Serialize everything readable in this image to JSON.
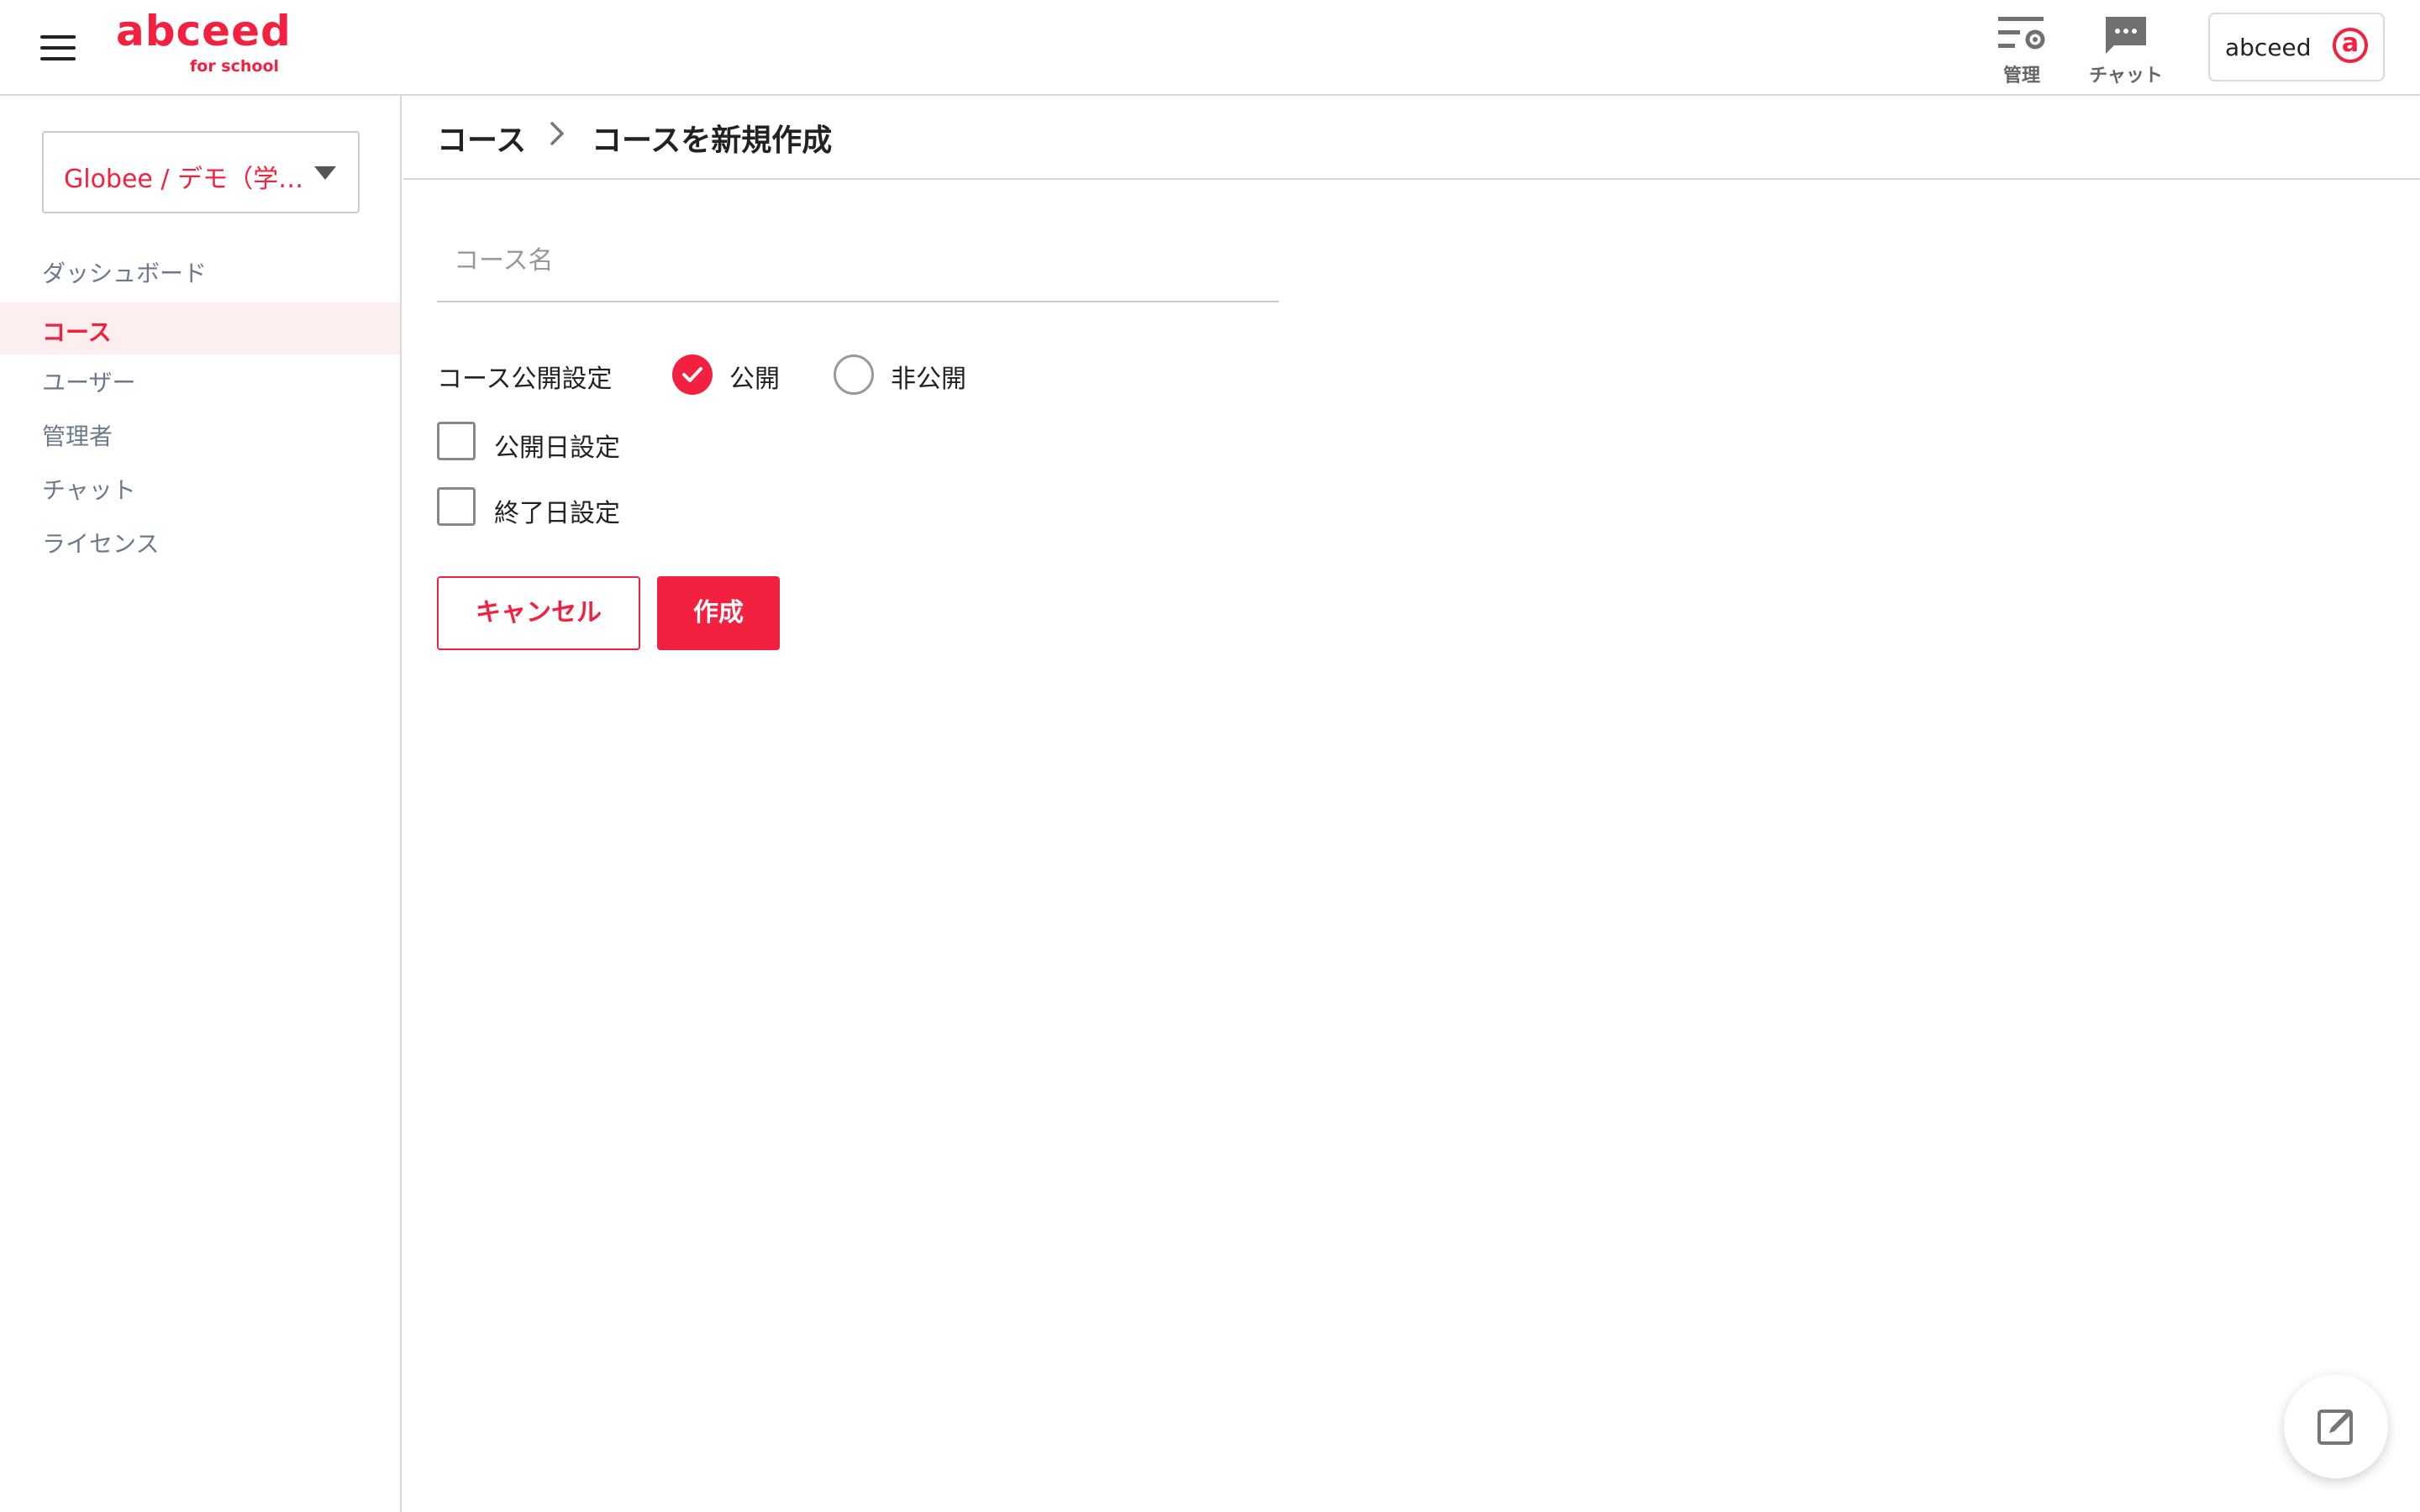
{
  "colors": {
    "accent": "#f2213f",
    "nav_text": "#6b7a8c",
    "active_bg": "#fdeeef"
  },
  "header": {
    "logo_main": "abceed",
    "logo_sub": "for school",
    "manage_label": "管理",
    "chat_label": "チャット",
    "account_name": "abceed",
    "account_avatar": "a"
  },
  "sidebar": {
    "org_select": "Globee / デモ（学…",
    "items": [
      {
        "label": "ダッシュボード",
        "active": false
      },
      {
        "label": "コース",
        "active": true
      },
      {
        "label": "ユーザー",
        "active": false
      },
      {
        "label": "管理者",
        "active": false
      },
      {
        "label": "チャット",
        "active": false
      },
      {
        "label": "ライセンス",
        "active": false
      }
    ]
  },
  "breadcrumb": {
    "parent": "コース",
    "current": "コースを新規作成"
  },
  "form": {
    "course_name_placeholder": "コース名",
    "course_name_value": "",
    "visibility_label": "コース公開設定",
    "visibility_options": [
      "公開",
      "非公開"
    ],
    "visibility_selected": "公開",
    "publish_date_label": "公開日設定",
    "end_date_label": "終了日設定",
    "cancel_label": "キャンセル",
    "create_label": "作成"
  },
  "icons": {
    "menu": "hamburger-icon",
    "manage": "settings-list-icon",
    "chat": "chat-bubble-icon",
    "breadcrumb_separator": "chevron-right-icon",
    "fab": "edit-icon"
  }
}
